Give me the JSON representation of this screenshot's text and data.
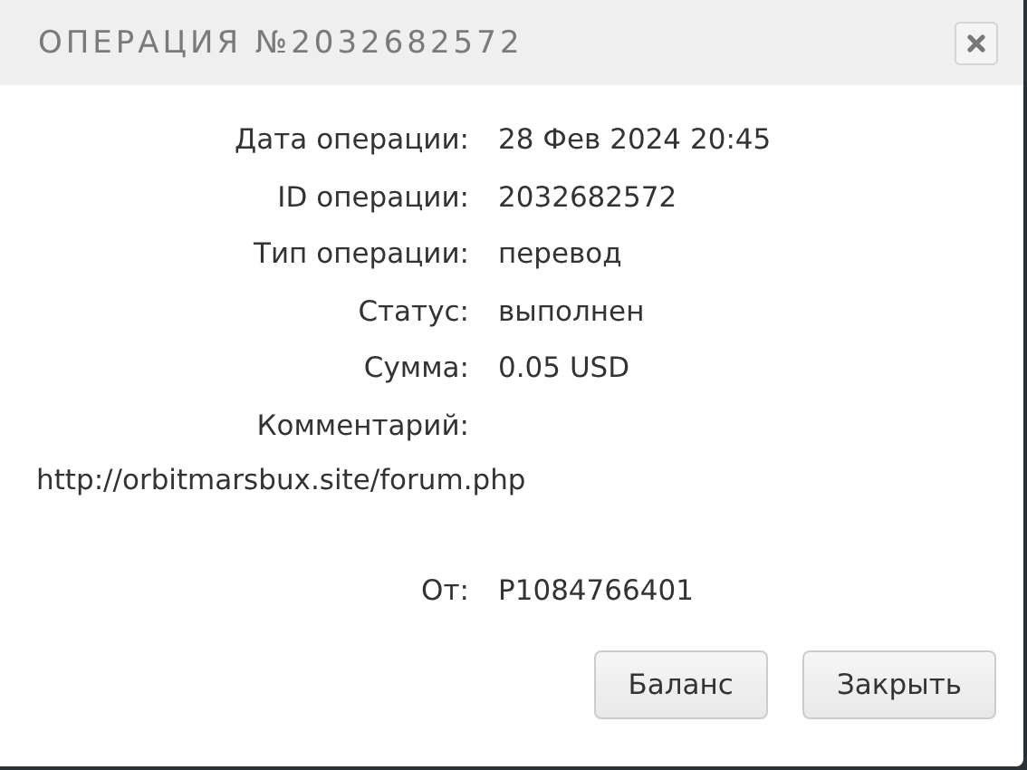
{
  "window": {
    "title": "ОПЕРАЦИЯ №2032682572"
  },
  "fields": [
    {
      "label": "Дата операции:",
      "value": "28 Фев 2024 20:45"
    },
    {
      "label": "ID операции:",
      "value": "2032682572"
    },
    {
      "label": "Тип операции:",
      "value": "перевод"
    },
    {
      "label": "Статус:",
      "value": "выполнен"
    },
    {
      "label": "Сумма:",
      "value": "0.05 USD"
    },
    {
      "label": "Комментарий:"
    }
  ],
  "comment": "http://orbitmarsbux.site/forum.php",
  "sender": {
    "label": "От:",
    "value": "P1084766401"
  },
  "buttons": [
    "Баланс",
    "Закрыть"
  ]
}
